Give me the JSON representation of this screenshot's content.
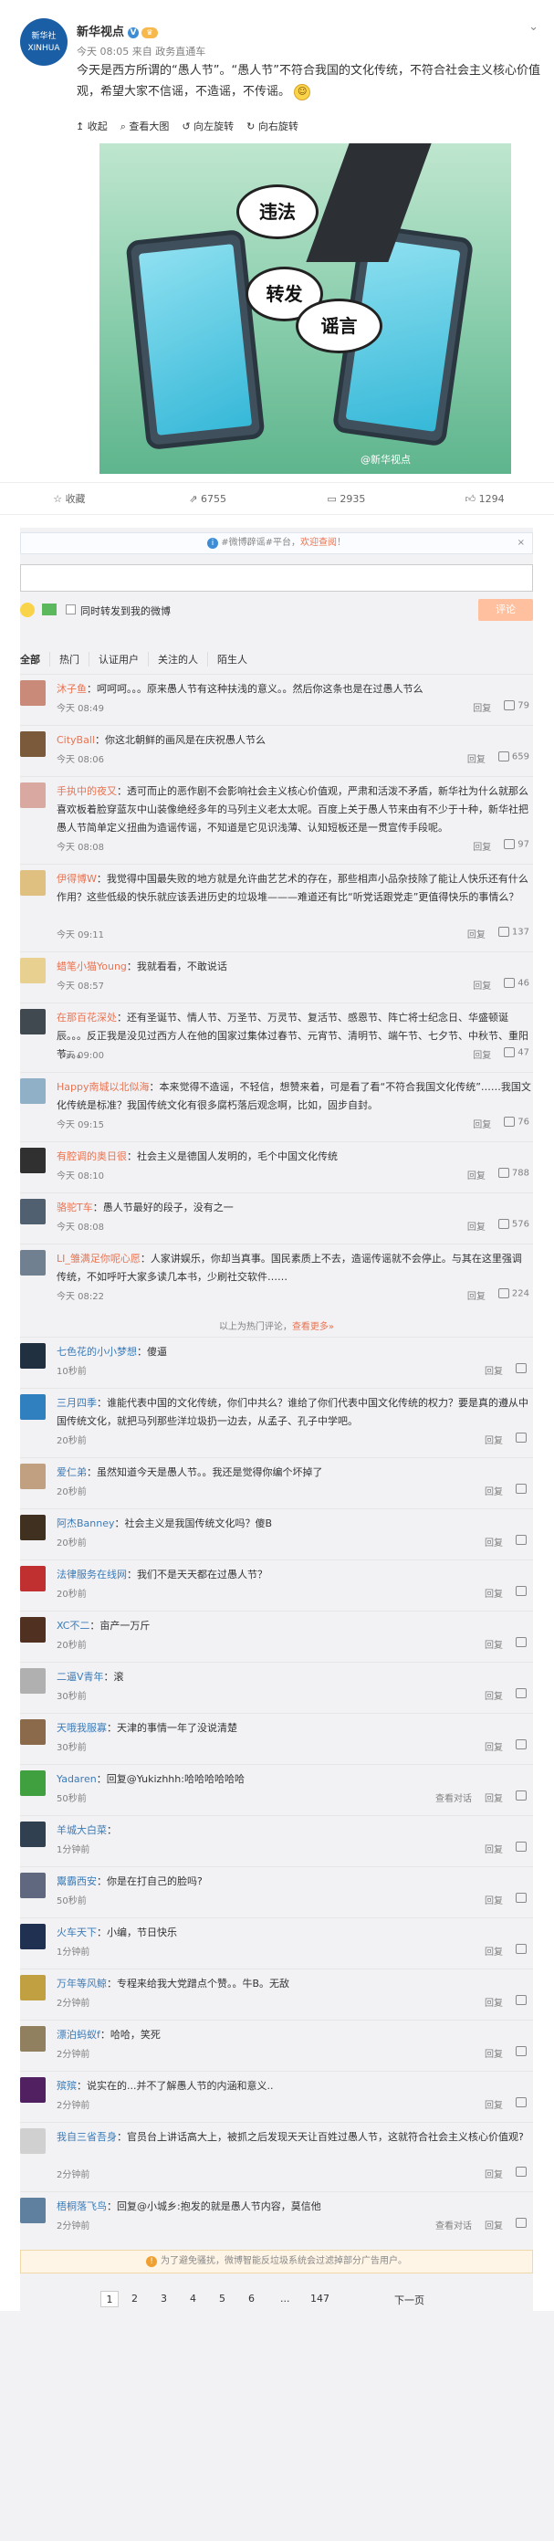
{
  "post": {
    "author": "新华视点",
    "avatar_text": "新华社 XINHUA",
    "time": "今天 08:05",
    "from_label": "来自",
    "source": "政务直通车",
    "text": "今天是西方所谓的“愚人节”。“愚人节”不符合我国的文化传统，不符合社会主义核心价值观，希望大家不信谣，不造谣，不传谣。",
    "toolbar": [
      "收起",
      "查看大图",
      "向左旋转",
      "向右旋转"
    ],
    "image_words": [
      "违法",
      "转发",
      "谣言"
    ],
    "image_watermark": "@新华视点"
  },
  "actions": [
    {
      "label": "收藏",
      "icon": "star-icon"
    },
    {
      "label": "6755",
      "icon": "repost-icon"
    },
    {
      "label": "2935",
      "icon": "comment-icon"
    },
    {
      "label": "1294",
      "icon": "like-icon"
    }
  ],
  "comments_area": {
    "notice_prefix": "#微博辟谣#平台，",
    "notice_link": "欢迎查阅！",
    "also_repost": "同时转发到我的微博",
    "post_button": "评论",
    "filters": [
      "全部",
      "热门",
      "认证用户",
      "关注的人",
      "陌生人"
    ]
  },
  "hot_comments": [
    {
      "name": "沐子鱼",
      "text": "：呵呵呵。。。原来愚人节有这种扶浅的意义。。然后你这条也是在过愚人节么",
      "time": "今天 08:49",
      "likes": "79",
      "reply": "回复",
      "color": "#c98a7a",
      "lines": 1
    },
    {
      "name": "CityBall",
      "text": "：你这北朝鲜的画风是在庆祝愚人节么",
      "time": "今天 08:06",
      "likes": "659",
      "reply": "回复",
      "color": "#7a5a3a",
      "lines": 1
    },
    {
      "name": "手执中的夜又",
      "text": "：透可而止的恶作剧不会影响社会主义核心价值观，严肃和活泼不矛盾，新华社为什么就那么喜欢板着脸穿蓝灰中山装像绝经多年的马列主义老太太呢。百度上关于愚人节来由有不少于十种，新华社把愚人节简单定义扭曲为造谣传谣，不知道是它见识浅薄、认知短板还是一贯宣传手段呢。",
      "time": "今天 08:08",
      "likes": "97",
      "reply": "回复",
      "color": "#d9a8a0",
      "lines": 3
    },
    {
      "name": "伊得博W",
      "text": "：我觉得中国最失败的地方就是允许曲艺艺术的存在，那些相声小品杂技除了能让人快乐还有什么作用？这些低级的快乐就应该丢进历史的垃圾堆———难道还有比“听党话跟党走”更值得快乐的事情么？",
      "time": "今天 09:11",
      "likes": "137",
      "reply": "回复",
      "color": "#e0c080",
      "lines": 3
    },
    {
      "name": "蜡笔小猫Young",
      "text": "：我就看看，不敢说话",
      "time": "今天 08:57",
      "likes": "46",
      "reply": "回复",
      "color": "#e8d090",
      "lines": 1
    },
    {
      "name": "在那百花深处",
      "text": "：还有圣诞节、情人节、万圣节、万灵节、复活节、感恩节、阵亡将士纪念日、华盛顿诞辰。。。反正我是没见过西方人在他的国家过集体过春节、元宵节、清明节、端午节、七夕节、中秋节、重阳节。。。",
      "time": "今天 09:00",
      "likes": "47",
      "reply": "回复",
      "color": "#404850",
      "lines": 2
    },
    {
      "name": "Happy南城以北似海",
      "text": "：本来觉得不造谣，不轻信，想赞来着，可是看了看“不符合我国文化传统”……我国文化传统是标准？我国传统文化有很多腐朽落后观念啊，比如，固步自封。",
      "time": "今天 09:15",
      "likes": "76",
      "reply": "回复",
      "color": "#90b0c8",
      "lines": 2
    },
    {
      "name": "有腔调的奥日很",
      "text": "：社会主义是德国人发明的，毛个中国文化传统",
      "time": "今天 08:10",
      "likes": "788",
      "reply": "回复",
      "color": "#303030",
      "lines": 1
    },
    {
      "name": "骆驼T车",
      "text": "：愚人节最好的段子，没有之一",
      "time": "今天 08:08",
      "likes": "576",
      "reply": "回复",
      "color": "#506070",
      "lines": 1
    },
    {
      "name": "LI_雏满足你呢心愿",
      "text": "：人家讲娱乐，你却当真事。国民素质上不去，造谣传谣就不会停止。与其在这里强调传统，不如呼吁大家多读几本书，少刷社交软件……",
      "time": "今天 08:22",
      "likes": "224",
      "reply": "回复",
      "color": "#708090",
      "lines": 2
    }
  ],
  "hot_footer": {
    "text": "以上为热门评论，",
    "link": "查看更多»"
  },
  "comments": [
    {
      "name": "七色花的小小梦想",
      "text": "：傻逼",
      "time": "10秒前",
      "color": "#203040",
      "lines": 1
    },
    {
      "name": "三月四季",
      "text": "：谁能代表中国的文化传统，你们中共么？谁给了你们代表中国文化传统的权力？要是真的遵从中国传统文化，就把马列那些洋垃圾扔一边去，从孟子、孔子中学吧。",
      "time": "20秒前",
      "color": "#3080c0",
      "lines": 2
    },
    {
      "name": "爱仁弟",
      "text": "：虽然知道今天是愚人节。。我还是觉得你编个坏掉了",
      "time": "20秒前",
      "color": "#c0a080",
      "lines": 1
    },
    {
      "name": "阿杰Banney",
      "text": "：社会主义是我国传统文化吗？傻B",
      "time": "20秒前",
      "color": "#403020",
      "lines": 1
    },
    {
      "name": "法律服务在线网",
      "text": "：我们不是天天都在过愚人节？",
      "time": "20秒前",
      "color": "#c03030",
      "lines": 1
    },
    {
      "name": "XC不二",
      "text": "：亩产一万斤",
      "time": "20秒前",
      "color": "#503020",
      "lines": 1
    },
    {
      "name": "二逼V青年",
      "text": "：滚",
      "time": "30秒前",
      "color": "#b0b0b0",
      "lines": 1
    },
    {
      "name": "天哦我服寡",
      "text": "：天津的事情一年了没说清楚",
      "time": "30秒前",
      "color": "#8a6a4a",
      "lines": 1
    },
    {
      "name": "Yadaren",
      "text": "：回复@Yukizhhh:哈哈哈哈哈哈",
      "time": "50秒前",
      "color": "#40a040",
      "lines": 1,
      "extra": "查看对话"
    },
    {
      "name": "羊城大白菜",
      "text": "：",
      "time": "1分钟前",
      "color": "#304050",
      "lines": 1
    },
    {
      "name": "鬻霸西安",
      "text": "：你是在打自己的脸吗?",
      "time": "50秒前",
      "color": "#606880",
      "lines": 1
    },
    {
      "name": "火车天下",
      "text": "：小编，节日快乐",
      "time": "1分钟前",
      "color": "#203050",
      "lines": 1
    },
    {
      "name": "万年等风鲸",
      "text": "：专程来给我大党蹭点个赞。。牛B。无敌",
      "time": "2分钟前",
      "color": "#c0a040",
      "lines": 1
    },
    {
      "name": "漂泊蚂蚁f",
      "text": "：哈哈，笑死",
      "time": "2分钟前",
      "color": "#908060",
      "lines": 1
    },
    {
      "name": "殡殡",
      "text": "：说实在的...并不了解愚人节的内涵和意义..",
      "time": "2分钟前",
      "color": "#502060",
      "lines": 1
    },
    {
      "name": "我自三省吾身",
      "text": "：官员台上讲话高大上，被抓之后发现天天让百姓过愚人节，这就符合社会主义核心价值观?",
      "time": "2分钟前",
      "color": "#d0d0d0",
      "lines": 2
    },
    {
      "name": "梧桐落飞鸟",
      "text": "：回复@小城乡:抱发的就是愚人节内容，莫信他",
      "time": "2分钟前",
      "color": "#6080a0",
      "lines": 1,
      "extra": "查看对话"
    }
  ],
  "reply_label": "回复",
  "warning": "为了避免骚扰，微博智能反垃圾系统会过滤掉部分广告用户。",
  "pager": {
    "pages": [
      "1",
      "2",
      "3",
      "4",
      "5",
      "6"
    ],
    "ellipsis": "...",
    "last": "147",
    "next": "下一页"
  }
}
